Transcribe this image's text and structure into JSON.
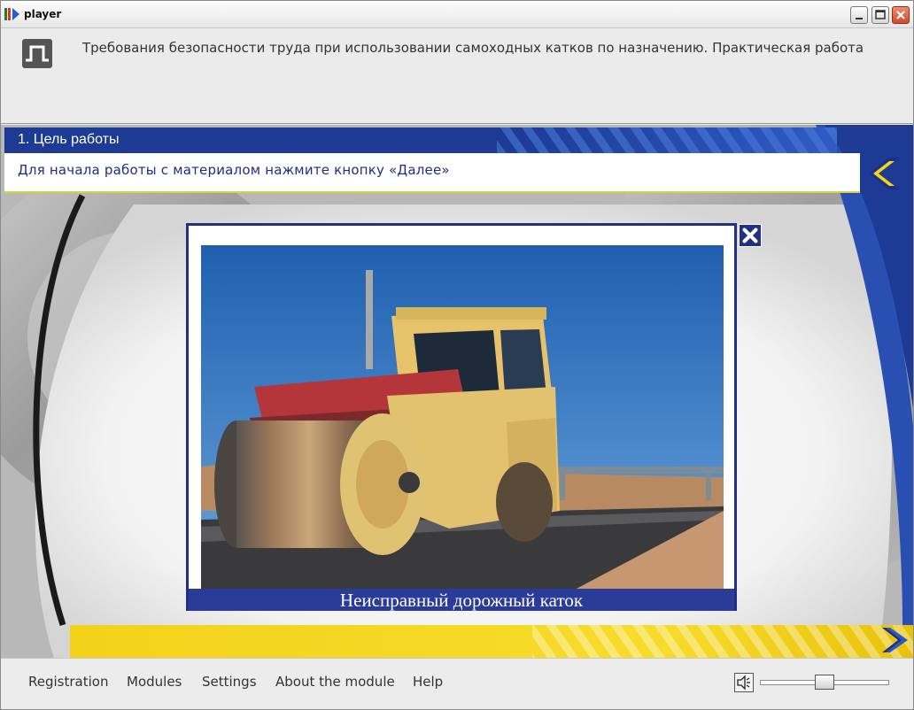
{
  "window": {
    "title": "player",
    "controls": [
      "minimize",
      "maximize",
      "close"
    ]
  },
  "header": {
    "logo_icon": "pi-logo-icon",
    "course_title": "Требования безопасности труда при использовании самоходных катков по назначению. Практическая работа"
  },
  "section": {
    "title": "1. Цель работы",
    "instruction": "Для начала работы с материалом нажмите кнопку «Далее»"
  },
  "popup": {
    "caption": "Неисправный дорожный каток",
    "close_icon": "close-x-icon"
  },
  "navigation": {
    "back_icon": "chevron-left-icon",
    "next_icon": "chevron-right-icon"
  },
  "footer": {
    "links": [
      "Registration",
      "Modules",
      "Settings",
      "About the module",
      "Help"
    ],
    "sound_icon": "speaker-icon",
    "volume": 0.5
  },
  "colors": {
    "brand_blue": "#1d3a94",
    "accent_yellow": "#f3d21a",
    "popup_border": "#232f86"
  }
}
